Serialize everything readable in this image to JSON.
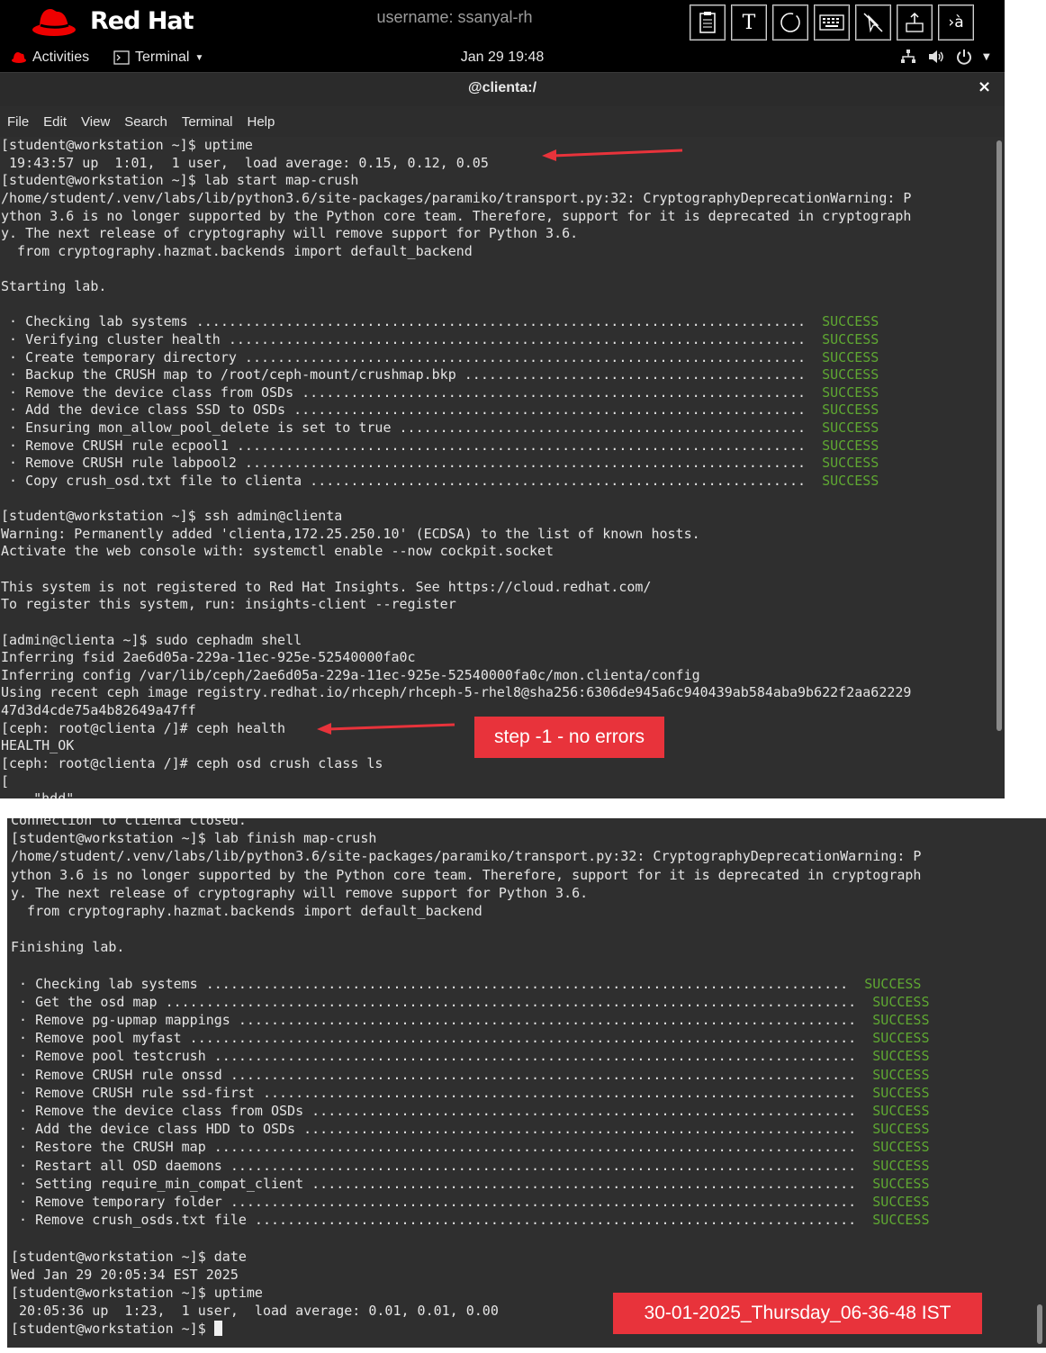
{
  "topbar": {
    "brand": "Red Hat",
    "username": "username: ssanyal-rh",
    "toolbar_icons": [
      "clipboard-icon",
      "text-t-icon",
      "circle-icon",
      "keyboard-icon",
      "mouse-off-icon",
      "upload-icon",
      "input-method-icon"
    ],
    "toolbar_text_t": "T",
    "toolbar_input": "›à"
  },
  "gnome": {
    "activities": "Activities",
    "app_menu": "Terminal",
    "clock": "Jan 29  19:48"
  },
  "window": {
    "title": "@clienta:/",
    "close": "×",
    "menu": [
      "File",
      "Edit",
      "View",
      "Search",
      "Terminal",
      "Help"
    ]
  },
  "terminal1": {
    "lines": [
      "[student@workstation ~]$ uptime",
      " 19:43:57 up  1:01,  1 user,  load average: 0.15, 0.12, 0.05",
      "[student@workstation ~]$ lab start map-crush",
      "/home/student/.venv/labs/lib/python3.6/site-packages/paramiko/transport.py:32: CryptographyDeprecationWarning: P",
      "ython 3.6 is no longer supported by the Python core team. Therefore, support for it is deprecated in cryptograph",
      "y. The next release of cryptography will remove support for Python 3.6.",
      "  from cryptography.hazmat.backends import default_backend",
      "",
      "Starting lab.",
      "",
      " · Checking lab systems ...........................................................................  SUCCESS",
      " · Verifying cluster health .......................................................................  SUCCESS",
      " · Create temporary directory .....................................................................  SUCCESS",
      " · Backup the CRUSH map to /root/ceph-mount/crushmap.bkp ..........................................  SUCCESS",
      " · Remove the device class from OSDs ..............................................................  SUCCESS",
      " · Add the device class SSD to OSDs ...............................................................  SUCCESS",
      " · Ensuring mon_allow_pool_delete is set to true ..................................................  SUCCESS",
      " · Remove CRUSH rule ecpool1 ......................................................................  SUCCESS",
      " · Remove CRUSH rule labpool2 .....................................................................  SUCCESS",
      " · Copy crush_osd.txt file to clienta .............................................................  SUCCESS",
      "",
      "[student@workstation ~]$ ssh admin@clienta",
      "Warning: Permanently added 'clienta,172.25.250.10' (ECDSA) to the list of known hosts.",
      "Activate the web console with: systemctl enable --now cockpit.socket",
      "",
      "This system is not registered to Red Hat Insights. See https://cloud.redhat.com/",
      "To register this system, run: insights-client --register",
      "",
      "[admin@clienta ~]$ sudo cephadm shell",
      "Inferring fsid 2ae6d05a-229a-11ec-925e-52540000fa0c",
      "Inferring config /var/lib/ceph/2ae6d05a-229a-11ec-925e-52540000fa0c/mon.clienta/config",
      "Using recent ceph image registry.redhat.io/rhceph/rhceph-5-rhel8@sha256:6306de945a6c940439ab584aba9b622f2aa62229",
      "47d3d4cde75a4b82649a47ff",
      "[ceph: root@clienta /]# ceph health",
      "HEALTH_OK",
      "[ceph: root@clienta /]# ceph osd crush class ls",
      "[",
      "    \"hdd\""
    ]
  },
  "terminal2": {
    "lines": [
      "Connection to clienta closed.",
      "[student@workstation ~]$ lab finish map-crush",
      "/home/student/.venv/labs/lib/python3.6/site-packages/paramiko/transport.py:32: CryptographyDeprecationWarning: P",
      "ython 3.6 is no longer supported by the Python core team. Therefore, support for it is deprecated in cryptograph",
      "y. The next release of cryptography will remove support for Python 3.6.",
      "  from cryptography.hazmat.backends import default_backend",
      "",
      "Finishing lab.",
      "",
      " · Checking lab systems ...............................................................................  SUCCESS",
      " · Get the osd map .....................................................................................  SUCCESS",
      " · Remove pg-upmap mappings ............................................................................  SUCCESS",
      " · Remove pool myfast ..................................................................................  SUCCESS",
      " · Remove pool testcrush ...............................................................................  SUCCESS",
      " · Remove CRUSH rule onssd .............................................................................  SUCCESS",
      " · Remove CRUSH rule ssd-first .........................................................................  SUCCESS",
      " · Remove the device class from OSDs ...................................................................  SUCCESS",
      " · Add the device class HDD to OSDs ....................................................................  SUCCESS",
      " · Restore the CRUSH map ...............................................................................  SUCCESS",
      " · Restart all OSD daemons .............................................................................  SUCCESS",
      " · Setting require_min_compat_client ...................................................................  SUCCESS",
      " · Remove temporary folder .............................................................................  SUCCESS",
      " · Remove crush_osds.txt file ..........................................................................  SUCCESS",
      "",
      "[student@workstation ~]$ date",
      "Wed Jan 29 20:05:34 EST 2025",
      "[student@workstation ~]$ uptime",
      " 20:05:36 up  1:23,  1 user,  load average: 0.01, 0.01, 0.00",
      "[student@workstation ~]$ "
    ]
  },
  "annotations": {
    "step1": "step -1 - no errors",
    "timestamp": "30-01-2025_Thursday_06-36-48 IST",
    "arrow_color": "#e8333b"
  },
  "colors": {
    "success": "#5fa832",
    "terminal_bg": "#2f2f2f",
    "callout": "#e8333b"
  }
}
